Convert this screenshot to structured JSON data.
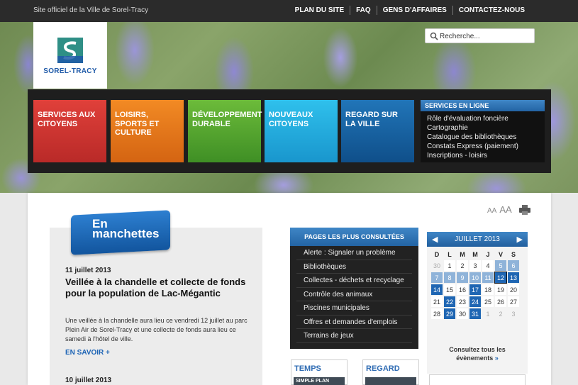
{
  "topbar": {
    "official": "Site officiel de la Ville de Sorel-Tracy",
    "nav": [
      "PLAN DU SITE",
      "FAQ",
      "GENS D'AFFAIRES",
      "CONTACTEZ-NOUS"
    ]
  },
  "logo": {
    "text": "SOREL-TRACY"
  },
  "search": {
    "placeholder": "Recherche..."
  },
  "menu": {
    "tiles": [
      "SERVICES AUX CITOYENS",
      "LOISIRS, SPORTS ET CULTURE",
      "DÉVELOPPEMENT DURABLE",
      "NOUVEAUX CITOYENS",
      "REGARD SUR LA VILLE"
    ],
    "tile_colors": [
      "#c8332f",
      "#e3781b",
      "#55a52f",
      "#23aee0",
      "#1863a4"
    ],
    "services": {
      "title": "SERVICES EN LIGNE",
      "items": [
        "Rôle d'évaluation foncière",
        "Cartographie",
        "Catalogue des bibliothèques",
        "Constats Express (paiement)",
        "Inscriptions - loisirs"
      ]
    }
  },
  "tools": {
    "text_small": "AA",
    "text_large": "AA",
    "print_icon": "printer-icon"
  },
  "news": {
    "badge_line1": "En",
    "badge_line2": "manchettes",
    "items": [
      {
        "date": "11 juillet 2013",
        "title": "Veillée à la chandelle et collecte de fonds pour la population de Lac-Mégantic",
        "body": "Une veillée à la chandelle aura lieu ce vendredi 12 juillet au parc Plein Air de Sorel-Tracy et une collecte de fonds aura lieu ce samedi à l'hôtel de ville.",
        "more": "EN SAVOIR +"
      },
      {
        "date": "10 juillet 2013"
      }
    ]
  },
  "popular": {
    "title": "PAGES LES PLUS CONSULTÉES",
    "items": [
      "Alerte : Signaler un problème",
      "Bibliothèques",
      "Collectes - déchets et recyclage",
      "Contrôle des animaux",
      "Piscines municipales",
      "Offres et demandes d'emplois",
      "Terrains de jeux"
    ]
  },
  "thumbs": [
    {
      "title": "TEMPS",
      "bar": "SIMPLE PLAN"
    },
    {
      "title": "REGARD",
      "bar": ""
    }
  ],
  "calendar": {
    "month": "JUILLET 2013",
    "prev": "◀",
    "next": "▶",
    "weekdays": [
      "D",
      "L",
      "M",
      "M",
      "J",
      "V",
      "S"
    ],
    "weeks": [
      [
        "30",
        "1",
        "2",
        "3",
        "4",
        "5",
        "6"
      ],
      [
        "7",
        "8",
        "9",
        "10",
        "11",
        "12",
        "13"
      ],
      [
        "14",
        "15",
        "16",
        "17",
        "18",
        "19",
        "20"
      ],
      [
        "21",
        "22",
        "23",
        "24",
        "25",
        "26",
        "27"
      ],
      [
        "28",
        "29",
        "30",
        "31",
        "1",
        "2",
        "3"
      ]
    ],
    "more_line1": "Consultez tous les",
    "more_line2": "évènements",
    "more_arrow": "»"
  }
}
